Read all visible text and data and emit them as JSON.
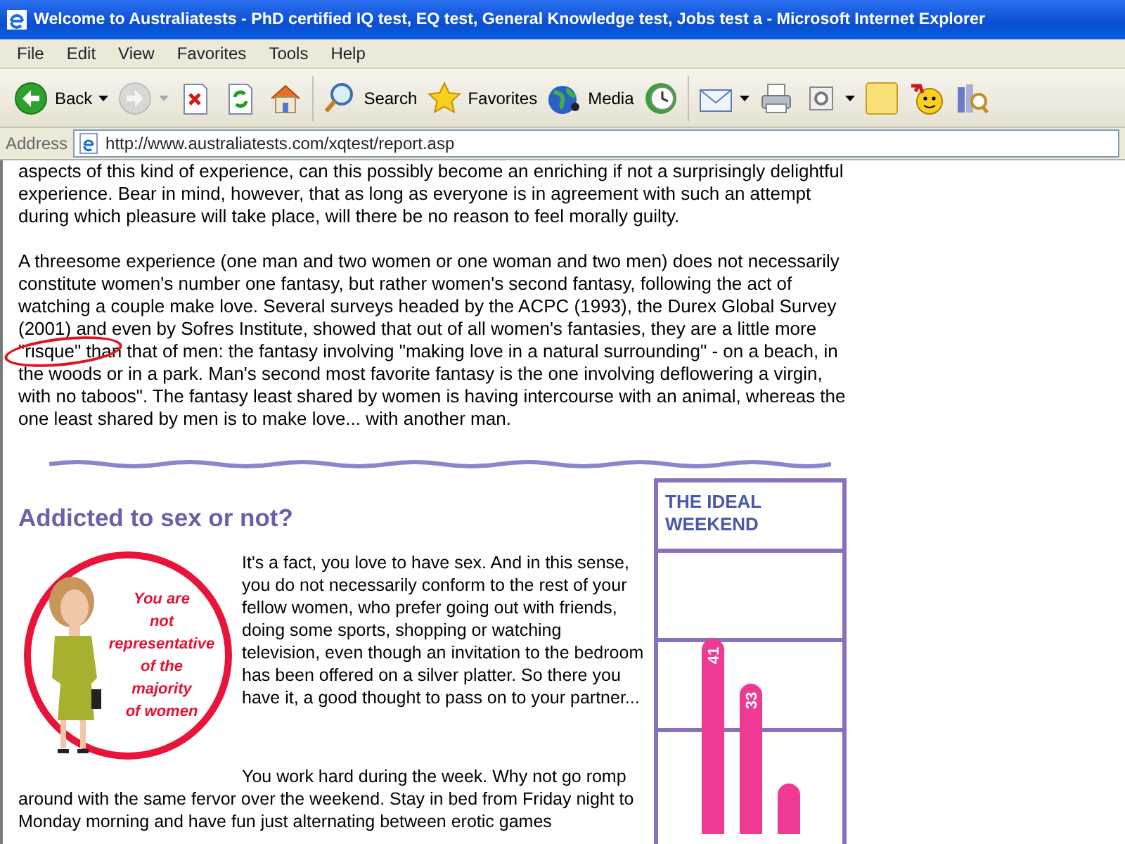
{
  "window": {
    "title": "Welcome to Australiatests - PhD certified IQ test, EQ test, General Knowledge test, Jobs test a - Microsoft Internet Explorer"
  },
  "menu": [
    "File",
    "Edit",
    "View",
    "Favorites",
    "Tools",
    "Help"
  ],
  "toolbar": [
    {
      "kind": "back",
      "label": "Back",
      "dropdown": true,
      "disabled": false
    },
    {
      "kind": "forward",
      "dropdown": true,
      "disabled": true
    },
    {
      "kind": "stop",
      "dropdown": false,
      "disabled": false
    },
    {
      "kind": "refresh",
      "dropdown": false,
      "disabled": false
    },
    {
      "kind": "home",
      "dropdown": false,
      "disabled": false
    },
    {
      "kind": "search",
      "label": "Search",
      "dropdown": false,
      "disabled": false
    },
    {
      "kind": "favorites",
      "label": "Favorites",
      "dropdown": false,
      "disabled": false
    },
    {
      "kind": "media",
      "label": "Media",
      "dropdown": false,
      "disabled": false
    },
    {
      "kind": "history",
      "dropdown": false,
      "disabled": false
    },
    {
      "kind": "mail",
      "dropdown": true,
      "disabled": false
    },
    {
      "kind": "print",
      "dropdown": false,
      "disabled": false
    },
    {
      "kind": "edit",
      "dropdown": true,
      "disabled": false
    },
    {
      "kind": "note",
      "dropdown": false,
      "disabled": false
    },
    {
      "kind": "messenger",
      "dropdown": false,
      "disabled": false
    },
    {
      "kind": "research",
      "dropdown": false,
      "disabled": false
    }
  ],
  "address": {
    "label": "Address",
    "url": "http://www.australiatests.com/xqtest/report.asp"
  },
  "article": {
    "paragraphs": [
      "aspects of this kind of experience, can this possibly become an enriching if not a surprisingly delightful experience. Bear in mind, however, that as long as everyone is in agreement with such an attempt during which pleasure will take place, will there be no reason to feel morally guilty.",
      "A threesome experience (one man and two women or one woman and two men) does not necessarily constitute women's number one fantasy, but rather women's second fantasy, following the act of watching a couple make love. Several surveys headed by the ACPC (1993), the Durex Global Survey (2001) and even by Sofres Institute, showed that out of all women's fantasies, they are a little more \"risque\" than that of men: the fantasy involving \"making love in a natural surrounding\" - on a beach, in the woods or in a park. Man's second most favorite fantasy is the one involving deflowering a virgin, with no taboos\". The fantasy least shared by women is having intercourse with an animal, whereas the one least shared by men is to make love... with another man."
    ],
    "section": {
      "heading": "Addicted to sex or not?",
      "badge_lines": [
        "You are",
        "not",
        "representative",
        "of the",
        "majority",
        "of women"
      ],
      "paragraphs": [
        "It's a fact, you love to have sex. And in this sense, you do not necessarily conform to the rest of your fellow women, who prefer going out with friends, doing some sports, shopping or watching television, even though an invitation to the bedroom has been offered on a silver platter. So there you have it, a good thought to pass on to your partner...",
        "You work hard during the week. Why not go romp around with the same fervor over the weekend. Stay in bed from Friday night to Monday morning and have fun just alternating between erotic games"
      ],
      "chart": {
        "title": "THE IDEAL WEEKEND",
        "bar_labels": [
          "41",
          "33"
        ]
      }
    }
  }
}
